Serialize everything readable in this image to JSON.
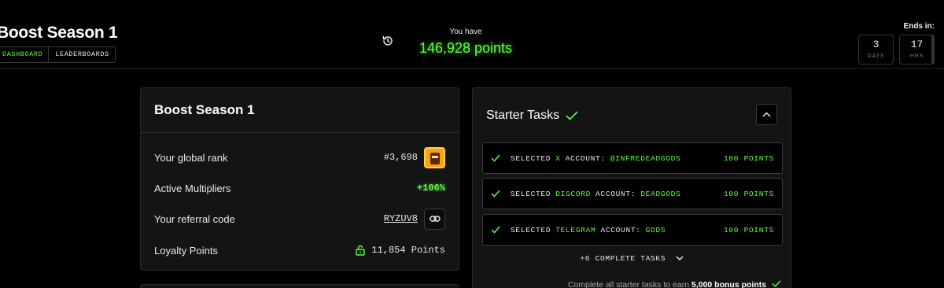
{
  "header": {
    "title": "Boost Season 1",
    "tabs": [
      {
        "label": "DASHBOARD",
        "active": true
      },
      {
        "label": "LEADERBOARDS",
        "active": false
      }
    ],
    "you_have_label": "You have",
    "points_value": "146,928 points",
    "ends_label": "Ends in:",
    "countdown": [
      {
        "value": "3",
        "unit": "DAYS"
      },
      {
        "value": "17",
        "unit": "HRS"
      }
    ]
  },
  "summary_card": {
    "title": "Boost Season 1",
    "rows": [
      {
        "label": "Your global rank",
        "value": "#3,698"
      },
      {
        "label": "Active Multipliers",
        "value": "+106%"
      },
      {
        "label": "Your referral code",
        "value": "RYZUV8"
      },
      {
        "label": "Loyalty Points",
        "value": "11,854 Points"
      }
    ]
  },
  "starter_tasks": {
    "title": "Starter Tasks",
    "tasks": [
      {
        "prefix": "SELECTED",
        "platform": "X",
        "suffix": "ACCOUNT:",
        "handle": "@INFREDEADGODS",
        "points": "100 POINTS"
      },
      {
        "prefix": "SELECTED",
        "platform": "DISCORD",
        "suffix": "ACCOUNT:",
        "handle": "DEADGODS",
        "points": "100 POINTS"
      },
      {
        "prefix": "SELECTED",
        "platform": "TELEGRAM",
        "suffix": "ACCOUNT:",
        "handle": "GODS",
        "points": "100 POINTS"
      }
    ],
    "more_label": "+6 COMPLETE TASKS",
    "bonus_text": "Complete all starter tasks to earn",
    "bonus_points": "5,000 bonus points"
  },
  "colors": {
    "accent_green": "#5dff3f",
    "background": "#000000",
    "card": "#141414",
    "avatar": "#f6a21a"
  },
  "icons": [
    "history-icon",
    "check-icon",
    "chevron-up-icon",
    "chevron-down-icon",
    "link-icon",
    "lock-icon"
  ]
}
